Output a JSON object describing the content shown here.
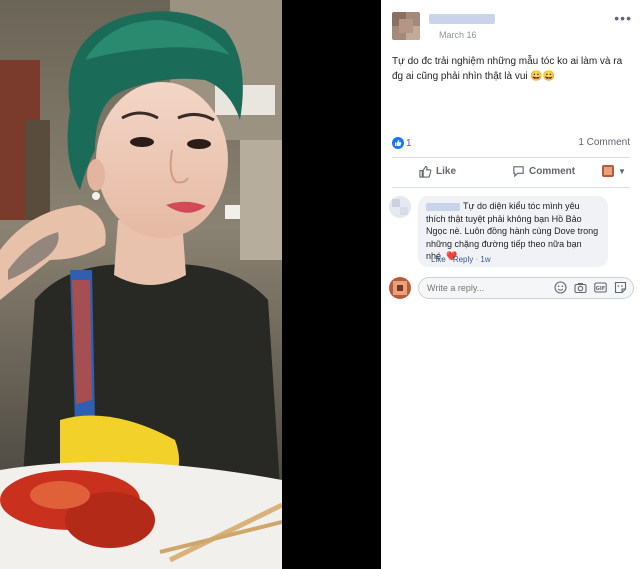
{
  "post": {
    "date": "March 16",
    "text": "Tự do đc trải nghiệm những mẫu tóc ko ai làm và ra đg ai cũng phải nhìn thật là vui 😀😀",
    "reaction_count": "1",
    "comment_count": "1 Comment"
  },
  "actions": {
    "like_label": "Like",
    "comment_label": "Comment"
  },
  "comment": {
    "text": "Tự do diện kiểu tóc mình yêu thích thật tuyệt phải không bạn Hồ Bảo Ngọc nè. Luôn đồng hành cùng Dove trong những chặng đường tiếp theo nữa bạn nhé.",
    "heart": "❤️",
    "like_label": "Like",
    "reply_label": "Reply",
    "time": "1w"
  },
  "reply": {
    "placeholder": "Write a reply..."
  },
  "icons": {
    "menu": "more-dots-icon",
    "like": "thumbs-up-icon",
    "comment": "comment-bubble-icon",
    "audience": "chevron-down-icon",
    "emoji": "emoji-icon",
    "camera": "camera-icon",
    "gif": "gif-icon",
    "sticker": "sticker-icon"
  },
  "colors": {
    "brand_blue": "#1877f2",
    "link_blue": "#385898",
    "heart_red": "#e0245e"
  }
}
